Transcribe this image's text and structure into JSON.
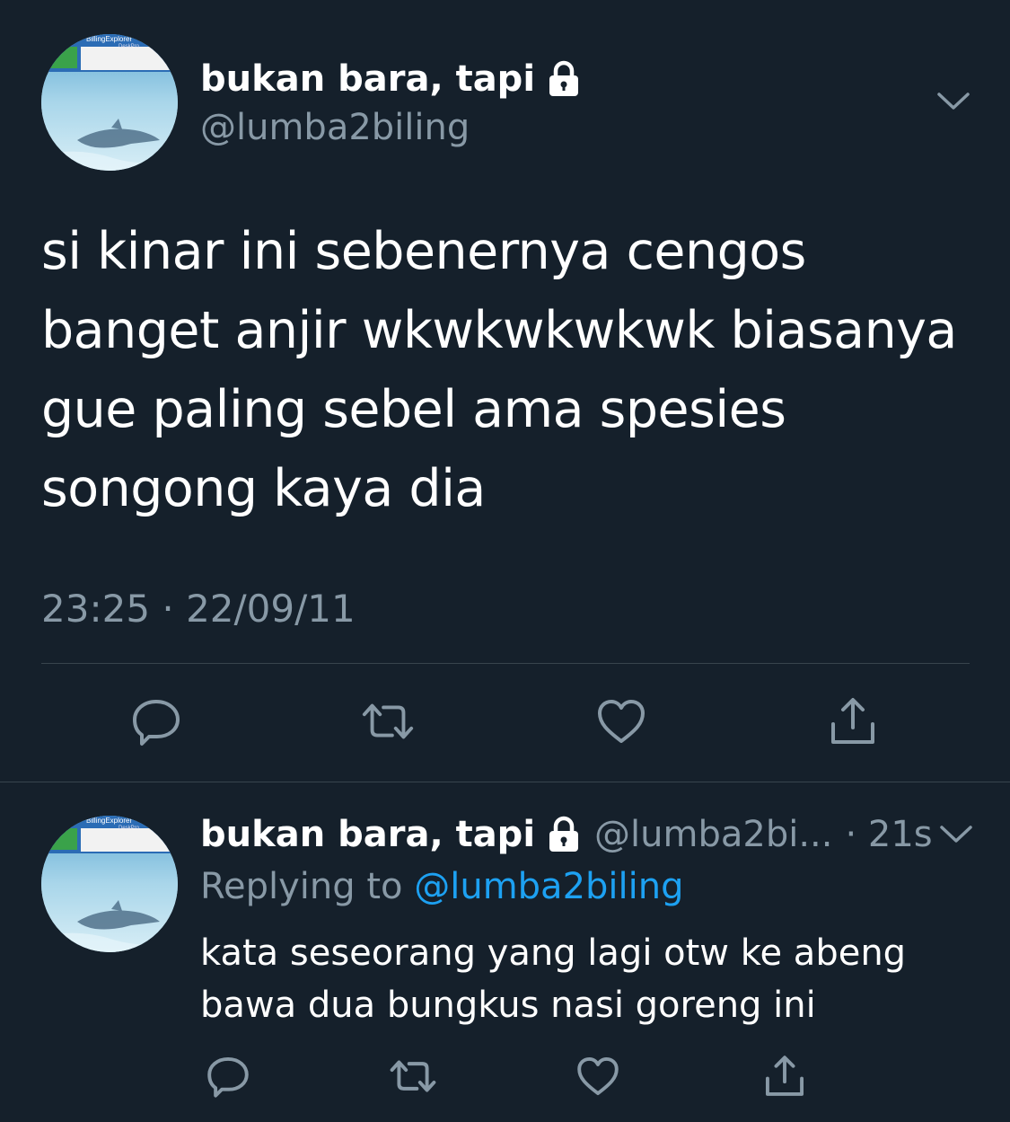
{
  "main_tweet": {
    "display_name": "bukan bara, tapi",
    "handle": "@lumba2biling",
    "text": "si kinar ini sebenernya cengos banget anjir wkwkwkwkwk biasanya gue paling sebel ama spesies songong kaya dia",
    "timestamp": "23:25 · 22/09/11",
    "avatar_label": "BillingExplorer",
    "avatar_sublabel": "DeskPro"
  },
  "reply_tweet": {
    "display_name": "bukan bara, tapi",
    "handle": "@lumba2bi...",
    "time": "· 21s",
    "replying_prefix": "Replying to",
    "replying_handle": "@lumba2biling",
    "text": "kata seseorang yang lagi otw ke abeng bawa dua bungkus nasi goreng ini",
    "avatar_label": "BillingExplorer",
    "avatar_sublabel": "DeskPro"
  },
  "icons": {
    "lock": "lock-icon",
    "chevron": "chevron-down-icon",
    "reply": "reply-icon",
    "retweet": "retweet-icon",
    "like": "like-icon",
    "share": "share-icon"
  },
  "colors": {
    "background": "#15202b",
    "secondary_text": "#8899a6",
    "divider": "#38444d",
    "link": "#1da1f2"
  }
}
